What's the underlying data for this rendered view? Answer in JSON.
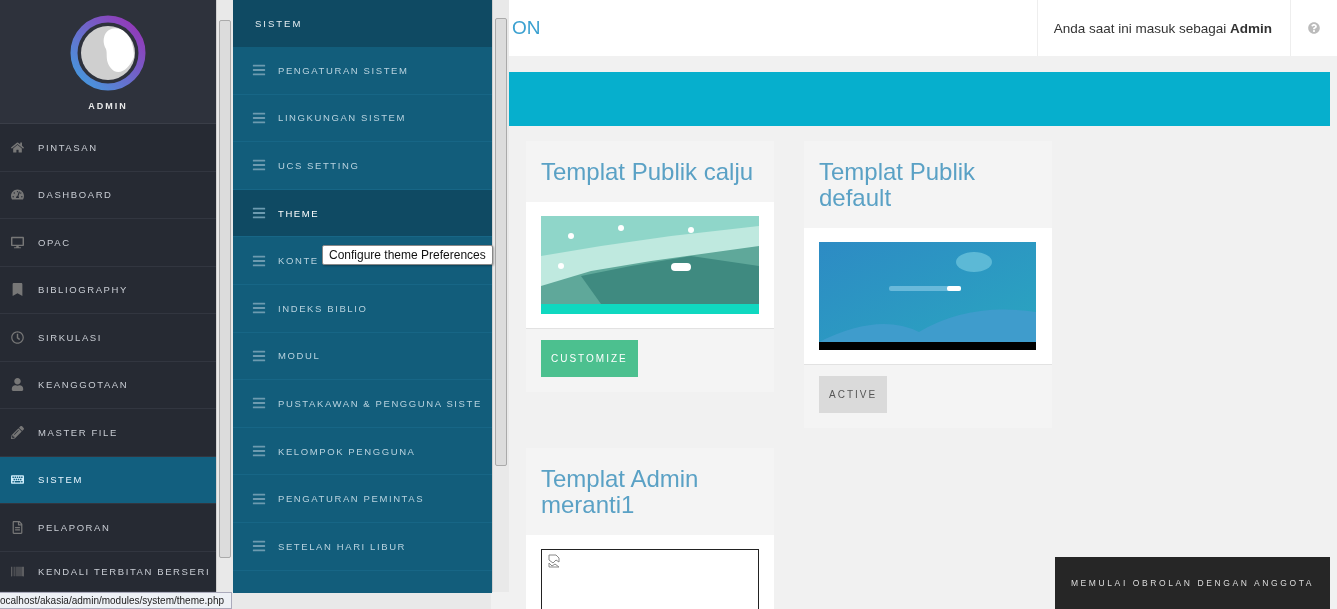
{
  "profile": {
    "name": "ADMIN"
  },
  "sidebar": {
    "items": [
      {
        "label": "PINTASAN",
        "selected": false
      },
      {
        "label": "DASHBOARD",
        "selected": false
      },
      {
        "label": "OPAC",
        "selected": false
      },
      {
        "label": "BIBLIOGRAPHY",
        "selected": false
      },
      {
        "label": "SIRKULASI",
        "selected": false
      },
      {
        "label": "KEANGGOTAAN",
        "selected": false
      },
      {
        "label": "MASTER FILE",
        "selected": false
      },
      {
        "label": "SISTEM",
        "selected": true
      },
      {
        "label": "PELAPORAN",
        "selected": false
      },
      {
        "label": "KENDALI TERBITAN BERSERI",
        "selected": false
      }
    ]
  },
  "submenu": {
    "title": "SISTEM",
    "items": [
      {
        "label": "PENGATURAN SISTEM",
        "selected": false
      },
      {
        "label": "LINGKUNGAN SISTEM",
        "selected": false
      },
      {
        "label": "UCS SETTING",
        "selected": false
      },
      {
        "label": "THEME",
        "selected": true
      },
      {
        "label": "KONTE",
        "selected": false
      },
      {
        "label": "INDEKS BIBLIO",
        "selected": false
      },
      {
        "label": "MODUL",
        "selected": false
      },
      {
        "label": "PUSTAKAWAN & PENGGUNA SISTE",
        "selected": false
      },
      {
        "label": "KELOMPOK PENGGUNA",
        "selected": false
      },
      {
        "label": "PENGATURAN PEMINTAS",
        "selected": false
      },
      {
        "label": "SETELAN HARI LIBUR",
        "selected": false
      }
    ]
  },
  "tooltip": "Configure theme Preferences",
  "header": {
    "title": "ON",
    "login_text": "Anda saat ini masuk sebagai **Admin**"
  },
  "templates": [
    {
      "title": "Templat Publik calju",
      "kind": "snow",
      "button": {
        "label": "CUSTOMIZE",
        "active": false
      }
    },
    {
      "title": "Templat Publik default",
      "kind": "blue",
      "button": {
        "label": "ACTIVE",
        "active": true
      }
    },
    {
      "title": "Templat Admin meranti1",
      "kind": "broken"
    }
  ],
  "chat": {
    "label": "MEMULAI OBROLAN DENGAN ANGGOTA"
  },
  "status_bar": {
    "url": "ocalhost/akasia/admin/modules/system/theme.php"
  }
}
